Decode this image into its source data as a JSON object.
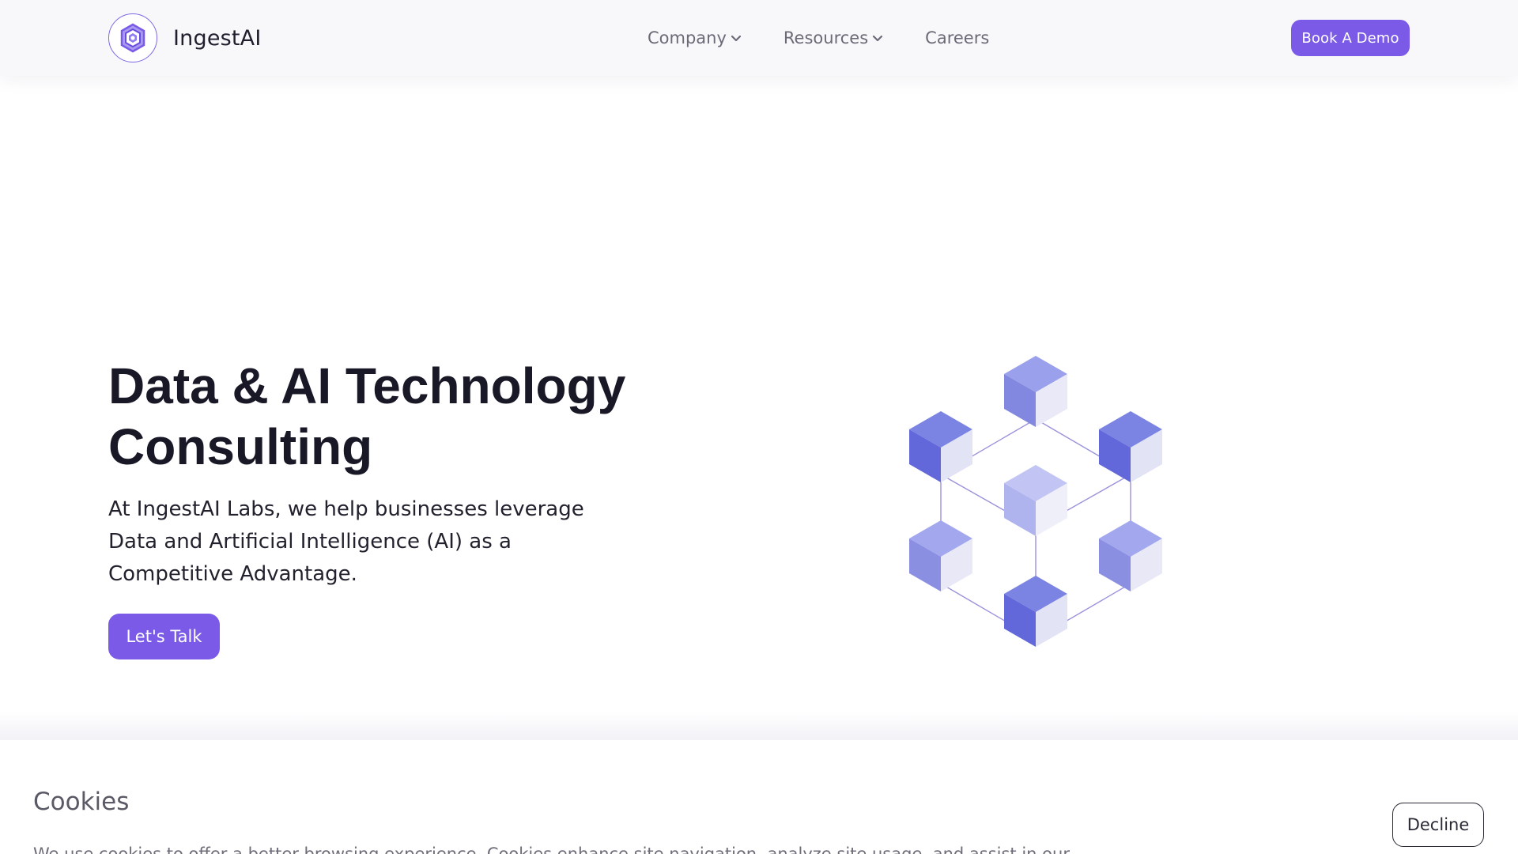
{
  "brand": {
    "name": "IngestAI",
    "accent": "#7a5ae6"
  },
  "nav": {
    "items": [
      {
        "label": "Company",
        "has_dropdown": true
      },
      {
        "label": "Resources",
        "has_dropdown": true
      },
      {
        "label": "Careers",
        "has_dropdown": false
      }
    ],
    "cta_label": "Book A Demo"
  },
  "hero": {
    "title_line1": "Data & AI Technology",
    "title_line2": "Consulting",
    "subtitle": "At IngestAI Labs, we help businesses leverage Data and Artificial Intelligence (AI) as a Competitive Advantage.",
    "cta_label": "Let's Talk",
    "graphic_icon": "cube-network-icon"
  },
  "cookie_banner": {
    "title": "Cookies",
    "text": "We use cookies to offer a better browsing experience. Cookies enhance site navigation, analyze site usage, and assist in our",
    "decline_label": "Decline"
  }
}
